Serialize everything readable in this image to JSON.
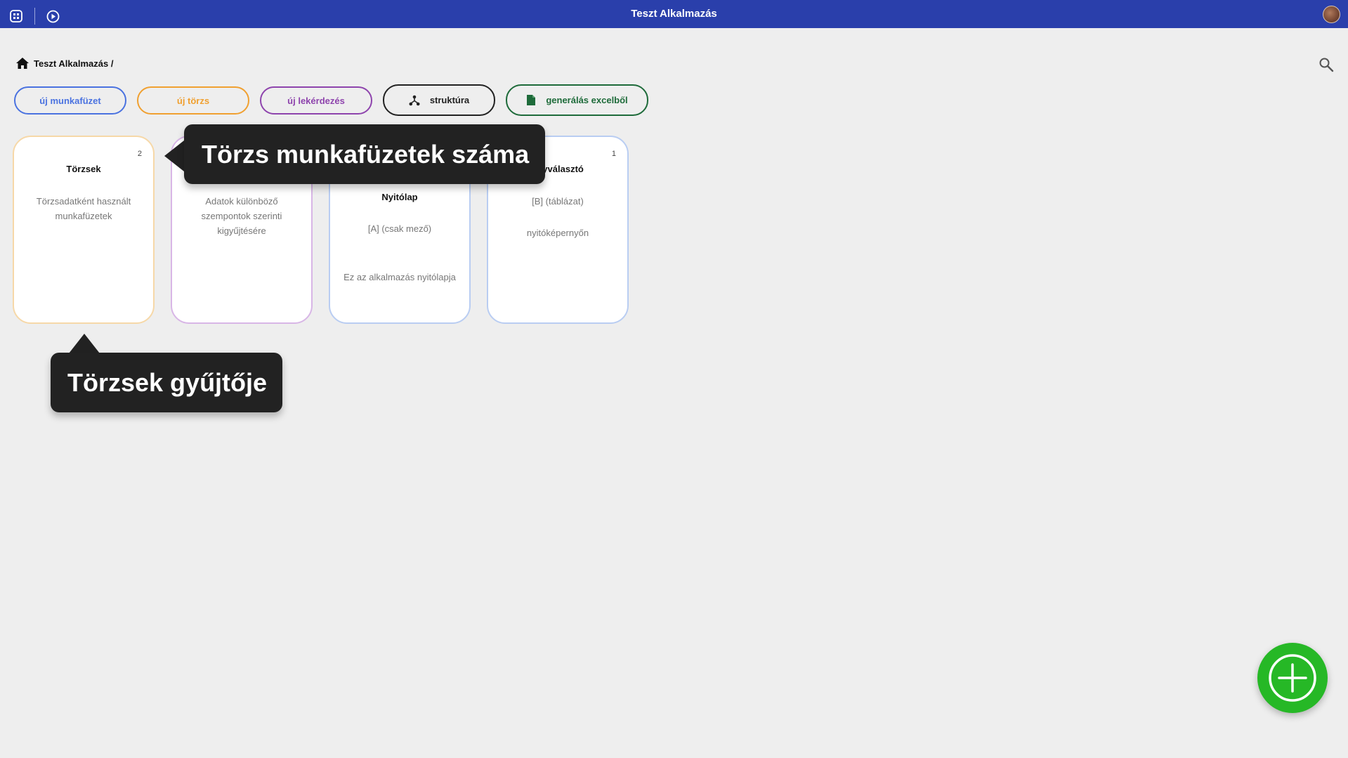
{
  "app": {
    "title": "Teszt Alkalmazás"
  },
  "topbar": {
    "icons": [
      "apps-grid-icon",
      "play-circle-icon"
    ],
    "avatar": "user-avatar"
  },
  "breadcrumb": {
    "label": "Teszt Alkalmazás /"
  },
  "actions": [
    {
      "label": "új munkafüzet",
      "color": "#4a72e0"
    },
    {
      "label": "új törzs",
      "color": "#f0a030"
    },
    {
      "label": "új lekérdezés",
      "color": "#8e44ad"
    },
    {
      "label": "struktúra",
      "color": "#222222",
      "icon": "hierarchy-icon"
    },
    {
      "label": "generálás excelből",
      "color": "#1e6b3a",
      "icon": "document-icon"
    }
  ],
  "cards": [
    {
      "title": "Törzsek",
      "count": "2",
      "description": "Törzsadatként használt munkafüzetek",
      "border": "#f6d8a8"
    },
    {
      "title": "",
      "count": "",
      "description": "Adatok különböző szempontok szerinti kigyűjtésére",
      "border": "#d8b6e6"
    },
    {
      "title": "Nyitólap",
      "count": "",
      "type": "[A] (csak mező)",
      "description": "Ez az alkalmazás nyitólapja",
      "border": "#b9cdf2"
    },
    {
      "title": "ényválasztó",
      "count": "1",
      "type": "[B] (táblázat)",
      "description": "nyitóképernyőn",
      "border": "#b9cdf2"
    }
  ],
  "tooltips": {
    "count_tip": "Törzs munkafüzetek száma",
    "collection_tip": "Törzsek gyűjtője"
  },
  "fab": {
    "icon": "plus-circle-icon"
  }
}
